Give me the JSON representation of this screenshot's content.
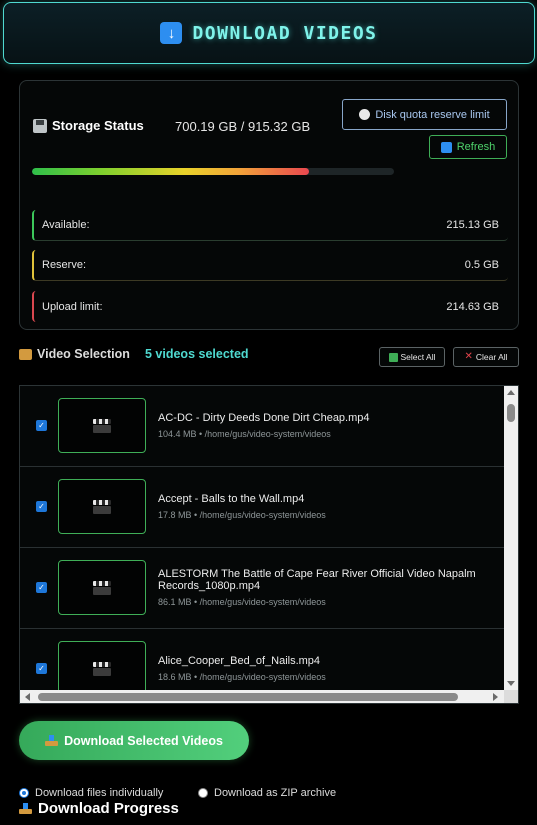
{
  "header": {
    "title": "DOWNLOAD VIDEOS",
    "icon": "down-arrow-icon"
  },
  "storage": {
    "title": "Storage Status",
    "value": "700.19 GB / 915.32 GB",
    "usage_fraction": 0.765,
    "quota_button": "Disk quota reserve limit",
    "refresh_button": "Refresh",
    "stats": [
      {
        "label": "Available:",
        "value": "215.13 GB",
        "color": "#3cc75a"
      },
      {
        "label": "Reserve:",
        "value": "0.5 GB",
        "color": "#e0c23a"
      },
      {
        "label": "Upload limit:",
        "value": "214.63 GB",
        "color": "#d9474f"
      }
    ]
  },
  "selection": {
    "title": "Video Selection",
    "count": "5 videos selected",
    "select_all": "Select All",
    "clear_all": "Clear All"
  },
  "videos": [
    {
      "name": "AC-DC - Dirty Deeds Done Dirt Cheap.mp4",
      "meta": "104.4 MB • /home/gus/video-system/videos",
      "checked": true
    },
    {
      "name": "Accept - Balls to the Wall.mp4",
      "meta": "17.8 MB • /home/gus/video-system/videos",
      "checked": true
    },
    {
      "name": "ALESTORM The Battle of Cape Fear River Official Video Napalm Records_1080p.mp4",
      "meta": "86.1 MB • /home/gus/video-system/videos",
      "checked": true
    },
    {
      "name": "Alice_Cooper_Bed_of_Nails.mp4",
      "meta": "18.6 MB • /home/gus/video-system/videos",
      "checked": true
    }
  ],
  "download": {
    "button": "Download Selected Videos",
    "option_individual": "Download files individually",
    "option_zip": "Download as ZIP archive",
    "selected_option": "individual"
  },
  "progress": {
    "title": "Download Progress"
  },
  "colors": {
    "accent": "#4fd9d0",
    "success": "#3fae57",
    "link": "#a9c8f0"
  }
}
